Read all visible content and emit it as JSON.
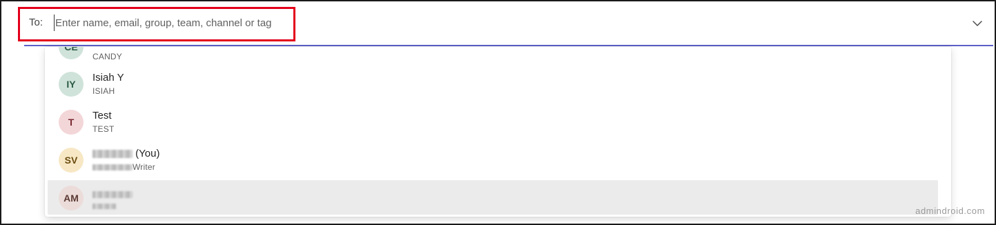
{
  "compose": {
    "to_label": "To:",
    "to_placeholder": "Enter name, email, group, team, channel or tag"
  },
  "suggestions": [
    {
      "initials": "CE",
      "name": "",
      "subtitle": "CANDY",
      "avatar_bg": "#cfe3da",
      "avatar_fg": "#2c5a45"
    },
    {
      "initials": "IY",
      "name": "Isiah Y",
      "subtitle": "ISIAH",
      "avatar_bg": "#cfe3da",
      "avatar_fg": "#2c5a45"
    },
    {
      "initials": "T",
      "name": "Test",
      "subtitle": "TEST",
      "avatar_bg": "#f3d6d8",
      "avatar_fg": "#7b2b33"
    },
    {
      "initials": "SV",
      "name_suffix": "(You)",
      "subtitle_suffix": "Writer",
      "avatar_bg": "#f7e7c4",
      "avatar_fg": "#6b4d10"
    },
    {
      "initials": "AM",
      "avatar_bg": "#ecdcd9",
      "avatar_fg": "#5b3a34",
      "selected": true
    }
  ],
  "watermark": "admindroid.com",
  "colors": {
    "underline": "#5b5fc7",
    "highlight": "#e3001b",
    "selected_row": "#ebebeb"
  },
  "icons": {
    "chevron": "chevron-down-icon"
  }
}
